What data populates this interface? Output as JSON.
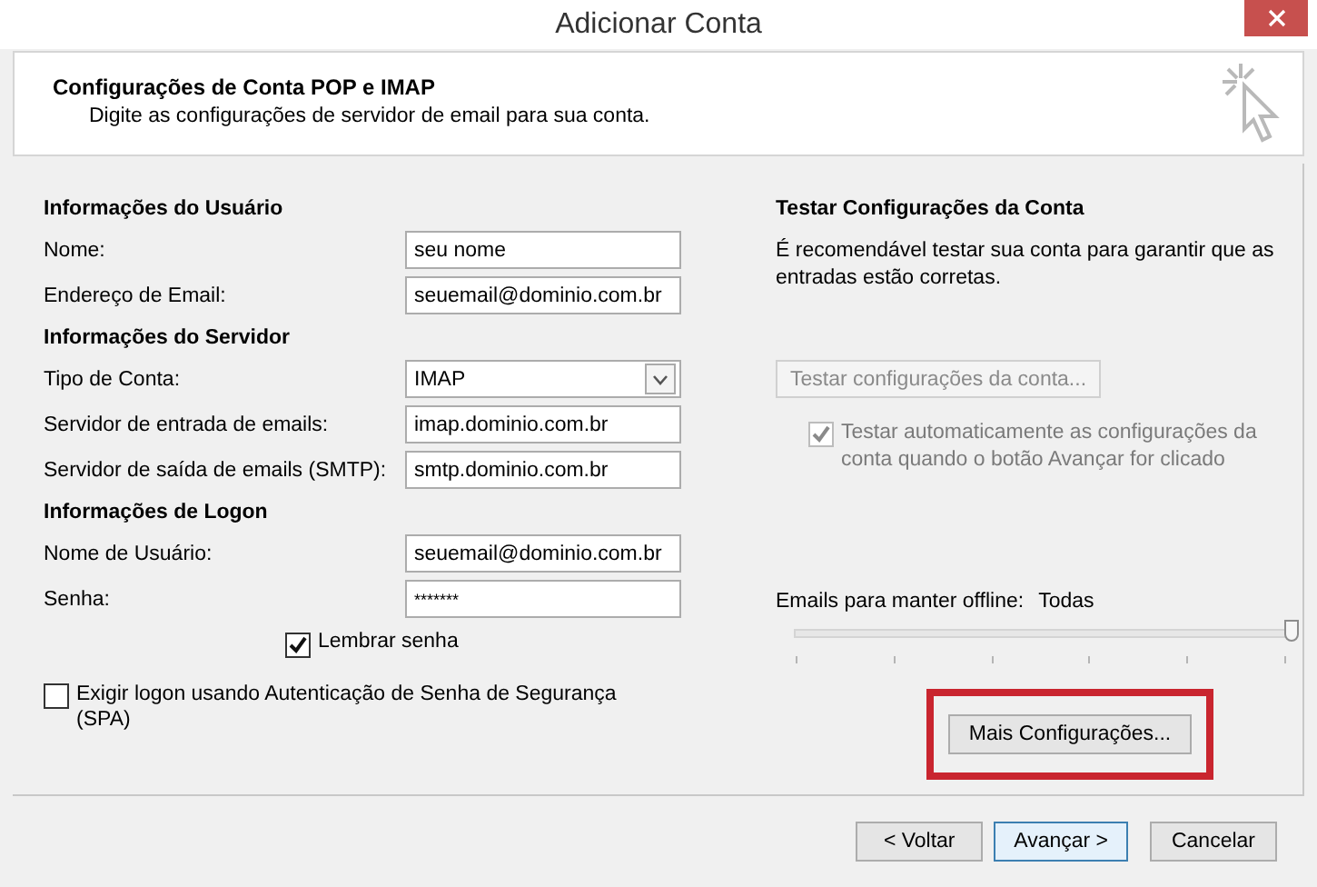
{
  "window": {
    "title": "Adicionar Conta"
  },
  "header": {
    "title": "Configurações de Conta POP e IMAP",
    "subtitle": "Digite as configurações de servidor de email para sua conta."
  },
  "sections": [
    {
      "heading": "Informações do Usuário",
      "fields": [
        {
          "label": "Nome:",
          "value": "seu nome",
          "kind": "text"
        },
        {
          "label": "Endereço de Email:",
          "value": "seuemail@dominio.com.br",
          "kind": "text"
        }
      ]
    },
    {
      "heading": "Informações do Servidor",
      "fields": [
        {
          "label": "Tipo de Conta:",
          "value": "IMAP",
          "kind": "select"
        },
        {
          "label": "Servidor de entrada de emails:",
          "value": "imap.dominio.com.br",
          "kind": "text"
        },
        {
          "label": "Servidor de saída de emails (SMTP):",
          "value": "smtp.dominio.com.br",
          "kind": "text"
        }
      ]
    },
    {
      "heading": "Informações de Logon",
      "fields": [
        {
          "label": "Nome de Usuário:",
          "value": "seuemail@dominio.com.br",
          "kind": "text"
        },
        {
          "label": "Senha:",
          "value": "*******",
          "kind": "password"
        }
      ]
    }
  ],
  "remember_password": {
    "label": "Lembrar senha",
    "checked": true
  },
  "spa": {
    "label": "Exigir logon usando Autenticação de Senha de Segurança (SPA)",
    "checked": false
  },
  "test": {
    "heading": "Testar Configurações da Conta",
    "description": "É recomendável testar sua conta para garantir que as entradas estão corretas.",
    "button": {
      "label": "Testar configurações da conta...",
      "disabled": true
    },
    "auto_test": {
      "label": "Testar automaticamente as configurações da conta quando o botão Avançar for clicado",
      "checked": true,
      "disabled": true
    }
  },
  "offline": {
    "label": "Emails para manter offline:",
    "value": "Todas",
    "level": 1
  },
  "more_settings": {
    "label": "Mais Configurações...",
    "highlighted": true
  },
  "buttons": [
    {
      "label": "< Voltar",
      "default": false
    },
    {
      "label": "Avançar >",
      "default": true
    },
    {
      "label": "Cancelar",
      "default": false
    }
  ]
}
